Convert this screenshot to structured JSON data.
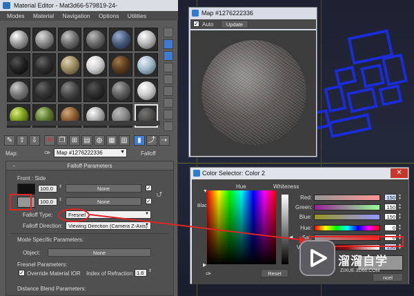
{
  "material_editor": {
    "title": "Material Editor - Mat3d66-579819-24-",
    "menu": [
      "Modes",
      "Material",
      "Navigation",
      "Options",
      "Utilities"
    ],
    "map_label": "Map:",
    "map_value": "Map #1276222336",
    "map_type": "Falloff",
    "rollout_title": "Falloff Parameters",
    "front_side_label": "Front : Side",
    "row1_value": "100.0",
    "row1_button": "None",
    "row2_value": "100.0",
    "row2_button": "None",
    "falloff_type_label": "Falloff Type:",
    "falloff_type_value": "Fresnel",
    "falloff_direction_label": "Falloff Direction:",
    "falloff_direction_value": "Viewing Direction (Camera Z-Axis)",
    "mode_specific_label": "Mode Specific Parameters:",
    "object_label": "Object:",
    "object_button": "None",
    "fresnel_label": "Fresnel Parameters:",
    "override_label": "Override Material IOR",
    "ior_label": "Index of Refraction",
    "ior_value": "1.6",
    "distance_blend_label": "Distance Blend Parameters:"
  },
  "map_window": {
    "title": "Map #1276222336",
    "auto_label": "Auto",
    "update_label": "Update"
  },
  "color_selector": {
    "title": "Color Selector: Color 2",
    "close_label": "✕",
    "hue_header": "Hue",
    "whiteness_header": "Whiteness",
    "blackness_label": "Blackness",
    "reset_label": "Reset",
    "cancel_label": "ncel",
    "rows": [
      {
        "label": "Red:",
        "value": "150"
      },
      {
        "label": "Green:",
        "value": "150"
      },
      {
        "label": "Blue:",
        "value": "150"
      },
      {
        "label": "Hue:",
        "value": "0"
      },
      {
        "label": "Sat:",
        "value": "0"
      },
      {
        "label": "Value:",
        "value": "150"
      }
    ]
  },
  "watermark": {
    "text": "溜溜自学",
    "url": "ZIXUE.3D66.COM"
  },
  "colors": {
    "selected_swatch": "#969696",
    "annotation_red": "#e02525",
    "frame_blue": "#1a2cd8"
  }
}
